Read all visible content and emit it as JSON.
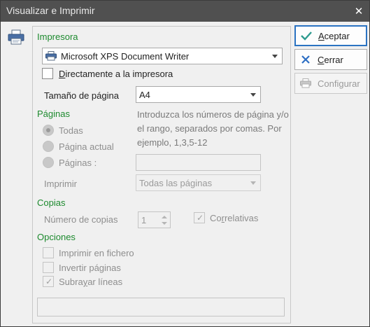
{
  "window": {
    "title": "Visualizar e Imprimir",
    "close_glyph": "✕"
  },
  "printer_section": {
    "title": "Impresora",
    "printer_name": "Microsoft XPS Document Writer",
    "direct_print_label_u": "D",
    "direct_print_label_rest": "irectamente a la impresora",
    "direct_print_checked": false,
    "page_size_label": "Tamaño de página",
    "page_size_value": "A4"
  },
  "pages_section": {
    "title": "Páginas",
    "radio_all": "Todas",
    "radio_current": "Página actual",
    "radio_pages": "Páginas :",
    "hint": "Introduzca los números de página y/o el rango, separados por comas. Por ejemplo, 1,3,5-12",
    "print_label": "Imprimir",
    "print_value": "Todas las páginas"
  },
  "copies_section": {
    "title": "Copias",
    "copies_label": "Número de copias",
    "copies_value": "1",
    "collate_label_a": "Co",
    "collate_label_u": "r",
    "collate_label_b": "relativas",
    "collate_checked": true
  },
  "options_section": {
    "title": "Opciones",
    "print_to_file": "Imprimir en fichero",
    "invert_pages": "Invertir páginas",
    "underline_a": "Subra",
    "underline_u": "y",
    "underline_b": "ar líneas",
    "underline_checked": true
  },
  "buttons": {
    "accept_u": "A",
    "accept_rest": "ceptar",
    "close_u": "C",
    "close_rest": "errar",
    "configure": "Configurar"
  },
  "icons": {
    "printer": "printer-icon",
    "accept": "check-icon",
    "close": "x-icon",
    "configure": "printer-icon"
  },
  "colors": {
    "section_title": "#1d8a2e",
    "accept_check": "#2e9b8f",
    "close_x": "#2d6fc4",
    "primary_border": "#2b73c2",
    "titlebar": "#505050"
  }
}
